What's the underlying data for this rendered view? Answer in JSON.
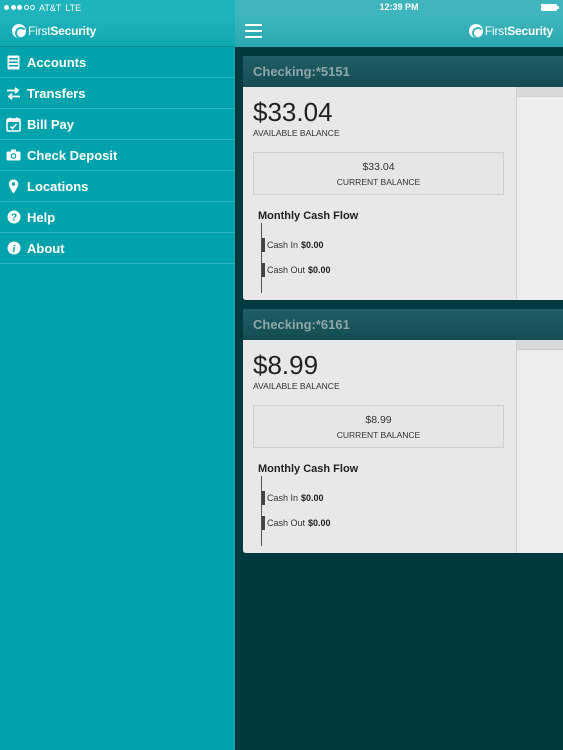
{
  "status_bar": {
    "carrier": "AT&T",
    "network": "LTE",
    "time": "12:39 PM"
  },
  "brand": {
    "logo_light": "First",
    "logo_bold": "Security"
  },
  "sidebar": {
    "items": [
      {
        "label": "Accounts",
        "icon": "accounts-icon"
      },
      {
        "label": "Transfers",
        "icon": "transfers-icon"
      },
      {
        "label": "Bill Pay",
        "icon": "calendar-icon"
      },
      {
        "label": "Check Deposit",
        "icon": "camera-icon"
      },
      {
        "label": "Locations",
        "icon": "location-pin-icon"
      },
      {
        "label": "Help",
        "icon": "help-icon"
      },
      {
        "label": "About",
        "icon": "info-icon"
      }
    ]
  },
  "accounts": [
    {
      "title": "Checking:*5151",
      "available": "$33.04",
      "available_label": "AVAILABLE BALANCE",
      "current": "$33.04",
      "current_label": "CURRENT BALANCE",
      "flow_title": "Monthly Cash Flow",
      "cash_in_label": "Cash In",
      "cash_in": "$0.00",
      "cash_out_label": "Cash Out",
      "cash_out": "$0.00"
    },
    {
      "title": "Checking:*6161",
      "available": "$8.99",
      "available_label": "AVAILABLE BALANCE",
      "current": "$8.99",
      "current_label": "CURRENT BALANCE",
      "flow_title": "Monthly Cash Flow",
      "cash_in_label": "Cash In",
      "cash_in": "$0.00",
      "cash_out_label": "Cash Out",
      "cash_out": "$0.00"
    }
  ],
  "colors": {
    "sidebar_bg": "#00a2ac",
    "main_bg": "#003a40",
    "card_header": "#1e5e66"
  }
}
